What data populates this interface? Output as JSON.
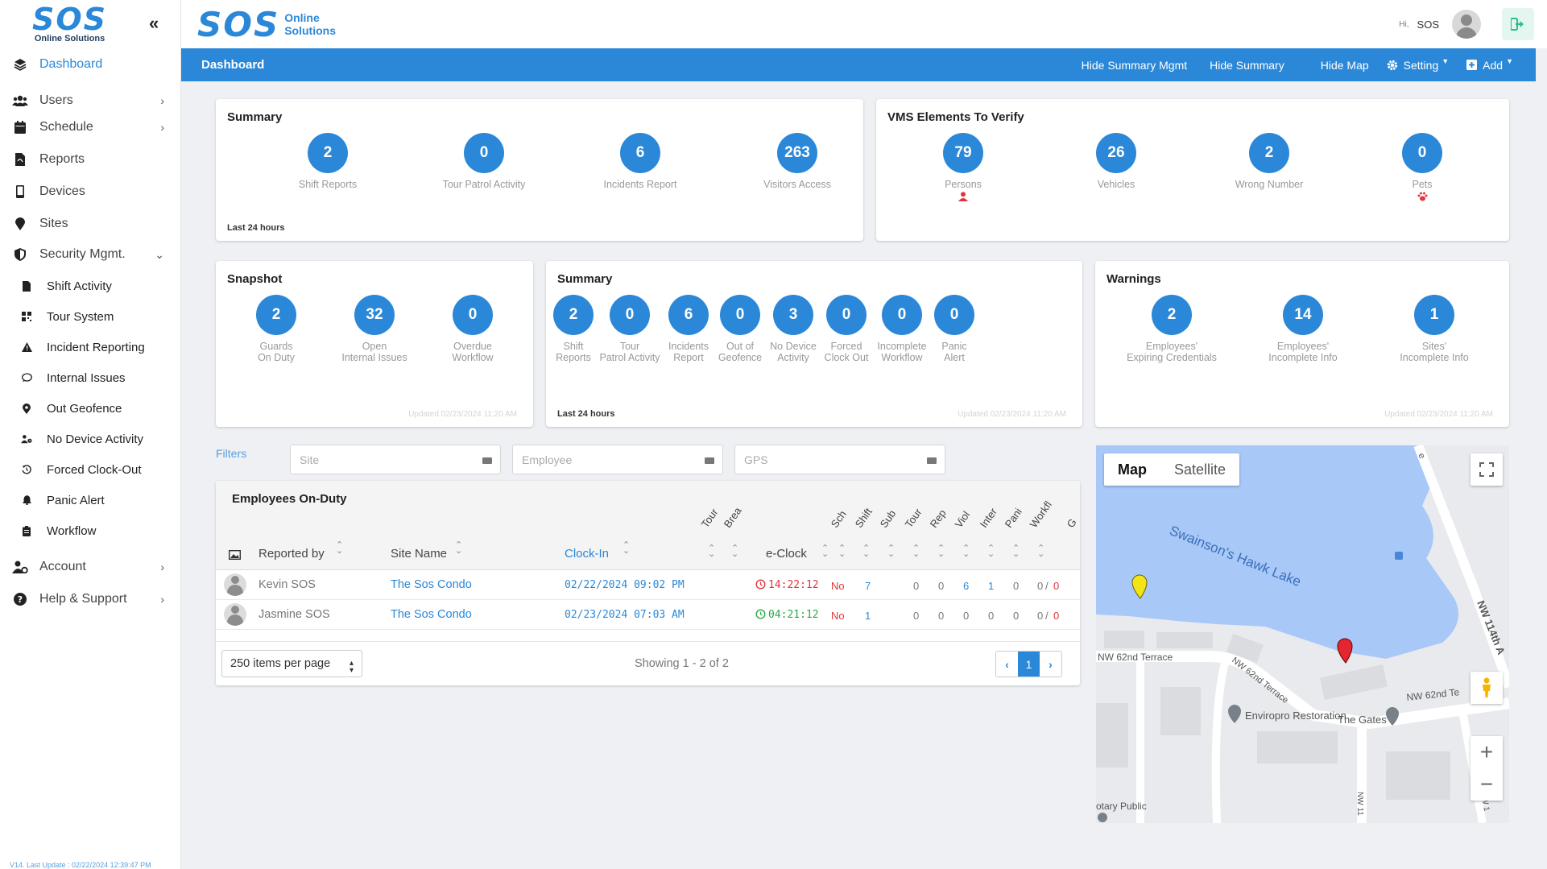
{
  "sidebar": {
    "logo_text": "SOS",
    "logo_sub": "Online Solutions",
    "collapse": "«",
    "items": [
      {
        "label": "Dashboard"
      },
      {
        "label": "Users"
      },
      {
        "label": "Schedule"
      },
      {
        "label": "Reports"
      },
      {
        "label": "Devices"
      },
      {
        "label": "Sites"
      },
      {
        "label": "Security Mgmt."
      },
      {
        "label": "Shift Activity"
      },
      {
        "label": "Tour System"
      },
      {
        "label": "Incident Reporting"
      },
      {
        "label": "Internal Issues"
      },
      {
        "label": "Out Geofence"
      },
      {
        "label": "No Device Activity"
      },
      {
        "label": "Forced Clock-Out"
      },
      {
        "label": "Panic Alert"
      },
      {
        "label": "Workflow"
      },
      {
        "label": "Account"
      },
      {
        "label": "Help & Support"
      }
    ],
    "version": "V14. Last Update : 02/22/2024 12:39:47 PM"
  },
  "header": {
    "logo_text": "SOS",
    "logo_line1": "Online",
    "logo_line2": "Solutions",
    "greeting": "Hi,",
    "user": "SOS"
  },
  "toolbar": {
    "title": "Dashboard",
    "hide_summary_mgmt": "Hide Summary Mgmt",
    "hide_summary": "Hide Summary",
    "hide_map": "Hide Map",
    "setting": "Setting",
    "add": "Add"
  },
  "summary1": {
    "title": "Summary",
    "footer": "Last 24 hours",
    "stats": [
      {
        "value": "2",
        "label": "Shift Reports"
      },
      {
        "value": "0",
        "label": "Tour Patrol Activity"
      },
      {
        "value": "6",
        "label": "Incidents Report"
      },
      {
        "value": "263",
        "label": "Visitors Access"
      }
    ]
  },
  "vms": {
    "title": "VMS Elements To Verify",
    "stats": [
      {
        "value": "79",
        "label": "Persons"
      },
      {
        "value": "26",
        "label": "Vehicles"
      },
      {
        "value": "2",
        "label": "Wrong Number"
      },
      {
        "value": "0",
        "label": "Pets"
      }
    ]
  },
  "snapshot": {
    "title": "Snapshot",
    "updated": "Updated 02/23/2024 11:20 AM",
    "stats": [
      {
        "value": "2",
        "line1": "Guards",
        "line2": "On Duty"
      },
      {
        "value": "32",
        "line1": "Open",
        "line2": "Internal Issues"
      },
      {
        "value": "0",
        "line1": "Overdue",
        "line2": "Workflow"
      }
    ]
  },
  "summary2": {
    "title": "Summary",
    "footer": "Last 24 hours",
    "updated": "Updated 02/23/2024 11:20 AM",
    "stats": [
      {
        "value": "2",
        "line1": "Shift",
        "line2": "Reports"
      },
      {
        "value": "0",
        "line1": "Tour",
        "line2": "Patrol Activity"
      },
      {
        "value": "6",
        "line1": "Incidents",
        "line2": "Report"
      },
      {
        "value": "0",
        "line1": "Out of",
        "line2": "Geofence"
      },
      {
        "value": "3",
        "line1": "No Device",
        "line2": "Activity"
      },
      {
        "value": "0",
        "line1": "Forced",
        "line2": "Clock Out"
      },
      {
        "value": "0",
        "line1": "Incomplete",
        "line2": "Workflow"
      },
      {
        "value": "0",
        "line1": "Panic",
        "line2": "Alert"
      }
    ]
  },
  "warnings": {
    "title": "Warnings",
    "updated": "Updated 02/23/2024 11:20 AM",
    "stats": [
      {
        "value": "2",
        "line1": "Employees'",
        "line2": "Expiring Credentials"
      },
      {
        "value": "14",
        "line1": "Employees'",
        "line2": "Incomplete Info"
      },
      {
        "value": "1",
        "line1": "Sites'",
        "line2": "Incomplete Info"
      }
    ]
  },
  "filters": {
    "label": "Filters",
    "site_placeholder": "Site",
    "employee_placeholder": "Employee",
    "gps_placeholder": "GPS"
  },
  "table": {
    "title": "Employees On-Duty",
    "headers": {
      "reported_by": "Reported by",
      "site_name": "Site Name",
      "clock_in": "Clock-In",
      "tour": "Tour",
      "break": "Brea",
      "eclock": "e-Clock",
      "sch": "Sch",
      "shift": "Shift",
      "sub": "Sub",
      "tour2": "Tour",
      "rep": "Rep",
      "viol": "Viol",
      "inter": "Inter",
      "pani": "Pani",
      "workfl": "Workfl",
      "g": "G"
    },
    "rows": [
      {
        "name": "Kevin SOS",
        "site": "The Sos Condo",
        "clock_in": "02/22/2024 09:02 PM",
        "eclock": "14:22:12",
        "status": "No",
        "c1": "7",
        "c2": "0",
        "c3": "0",
        "c4": "6",
        "c5": "1",
        "c6": "0",
        "c7": "0",
        "c8": "0"
      },
      {
        "name": "Jasmine SOS",
        "site": "The Sos Condo",
        "clock_in": "02/23/2024 07:03 AM",
        "eclock": "04:21:12",
        "status": "No",
        "c1": "1",
        "c2": "0",
        "c3": "0",
        "c4": "0",
        "c5": "0",
        "c6": "0",
        "c7": "0",
        "c8": "0"
      }
    ],
    "per_page": "250 items per page",
    "showing": "Showing 1 - 2 of 2",
    "page": "1"
  },
  "map": {
    "map_label": "Map",
    "satellite_label": "Satellite",
    "lake": "Swainson's Hawk Lake",
    "street1": "NW 62nd Terrace",
    "street2": "NW 62nd Terrace",
    "street3": "NW 62nd Te",
    "street4": "NW 114th A",
    "street5": "NW 11",
    "street6": "NW 1",
    "poi1": "Enviropro Restoration",
    "poi2": "The Gates",
    "poi3": "otary Public",
    "edge_label": "e"
  },
  "colors": {
    "brand": "#2b88d8",
    "lake": "#a8c8f8",
    "alert_red": "#e0363e",
    "ok_green": "#2aa844"
  }
}
